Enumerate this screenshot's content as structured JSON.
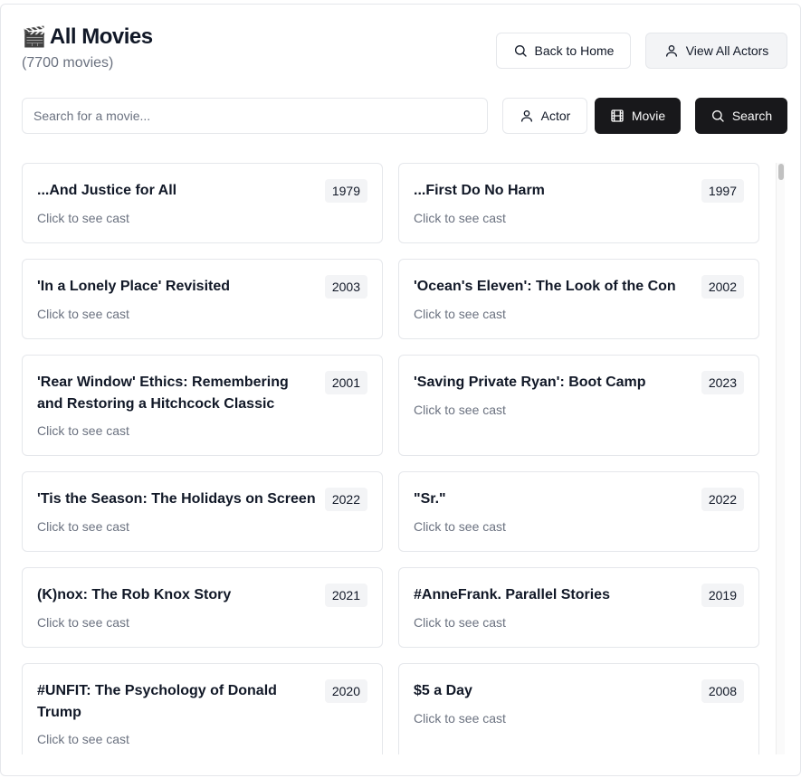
{
  "header": {
    "title_icon": "🎬",
    "title": "All Movies",
    "count": "(7700 movies)",
    "back_label": "Back to Home",
    "actors_label": "View All Actors"
  },
  "search": {
    "placeholder": "Search for a movie...",
    "value": "",
    "mode_actor_label": "Actor",
    "mode_movie_label": "Movie",
    "selected_mode": "Movie",
    "search_label": "Search"
  },
  "movies": [
    {
      "title": "...And Justice for All",
      "year": "1979",
      "hint": "Click to see cast"
    },
    {
      "title": "...First Do No Harm",
      "year": "1997",
      "hint": "Click to see cast"
    },
    {
      "title": "'In a Lonely Place' Revisited",
      "year": "2003",
      "hint": "Click to see cast"
    },
    {
      "title": "'Ocean's Eleven': The Look of the Con",
      "year": "2002",
      "hint": "Click to see cast"
    },
    {
      "title": "'Rear Window' Ethics: Remembering and Restoring a Hitchcock Classic",
      "year": "2001",
      "hint": "Click to see cast"
    },
    {
      "title": "'Saving Private Ryan': Boot Camp",
      "year": "2023",
      "hint": "Click to see cast"
    },
    {
      "title": "'Tis the Season: The Holidays on Screen",
      "year": "2022",
      "hint": "Click to see cast"
    },
    {
      "title": "\"Sr.\"",
      "year": "2022",
      "hint": "Click to see cast"
    },
    {
      "title": "(K)nox: The Rob Knox Story",
      "year": "2021",
      "hint": "Click to see cast"
    },
    {
      "title": "#AnneFrank. Parallel Stories",
      "year": "2019",
      "hint": "Click to see cast"
    },
    {
      "title": "#UNFIT: The Psychology of Donald Trump",
      "year": "2020",
      "hint": "Click to see cast"
    },
    {
      "title": "$5 a Day",
      "year": "2008",
      "hint": "Click to see cast"
    }
  ],
  "colors": {
    "accent_dark": "#18181b",
    "muted_text": "#6b7280",
    "border": "#e5e7eb",
    "badge_bg": "#f3f4f6"
  }
}
